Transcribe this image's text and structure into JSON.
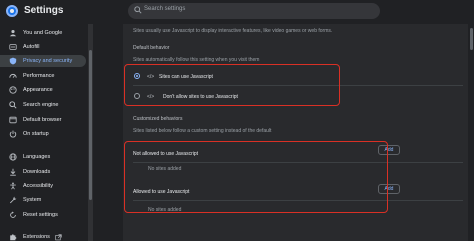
{
  "app": {
    "title": "Settings"
  },
  "search": {
    "placeholder": "Search settings"
  },
  "sidebar": {
    "items": [
      {
        "label": "You and Google",
        "icon": "person-icon"
      },
      {
        "label": "Autofill",
        "icon": "autofill-icon"
      },
      {
        "label": "Privacy and security",
        "icon": "shield-icon",
        "active": true
      },
      {
        "label": "Performance",
        "icon": "speedometer-icon"
      },
      {
        "label": "Appearance",
        "icon": "palette-icon"
      },
      {
        "label": "Search engine",
        "icon": "search-icon"
      },
      {
        "label": "Default browser",
        "icon": "browser-icon"
      },
      {
        "label": "On startup",
        "icon": "power-icon"
      },
      {
        "label": "Languages",
        "icon": "globe-icon"
      },
      {
        "label": "Downloads",
        "icon": "download-icon"
      },
      {
        "label": "Accessibility",
        "icon": "accessibility-icon"
      },
      {
        "label": "System",
        "icon": "wrench-icon"
      },
      {
        "label": "Reset settings",
        "icon": "reset-icon"
      },
      {
        "label": "Extensions",
        "icon": "puzzle-icon"
      }
    ]
  },
  "content": {
    "intro": "Sites usually use Javascript to display interactive features, like video games or web forms.",
    "default_behavior_heading": "Default behavior",
    "default_behavior_desc": "Sites automatically follow this setting when you visit them",
    "options": [
      {
        "label": "Sites can use Javascript",
        "icon": "code-icon",
        "selected": true
      },
      {
        "label": "Don't allow sites to use Javascript",
        "icon": "code-off-icon",
        "selected": false
      }
    ],
    "customized_heading": "Customized behaviors",
    "customized_desc": "Sites listed below follow a custom setting instead of the default",
    "not_allowed": {
      "title": "Not allowed to use Javascript",
      "add_label": "Add",
      "empty": "No sites added"
    },
    "allowed": {
      "title": "Allowed to use Javascript",
      "add_label": "Add",
      "empty": "No sites added"
    }
  },
  "colors": {
    "accent": "#8ab4f8",
    "highlight": "#d93025",
    "background": "#202124",
    "card": "#292a2d"
  }
}
